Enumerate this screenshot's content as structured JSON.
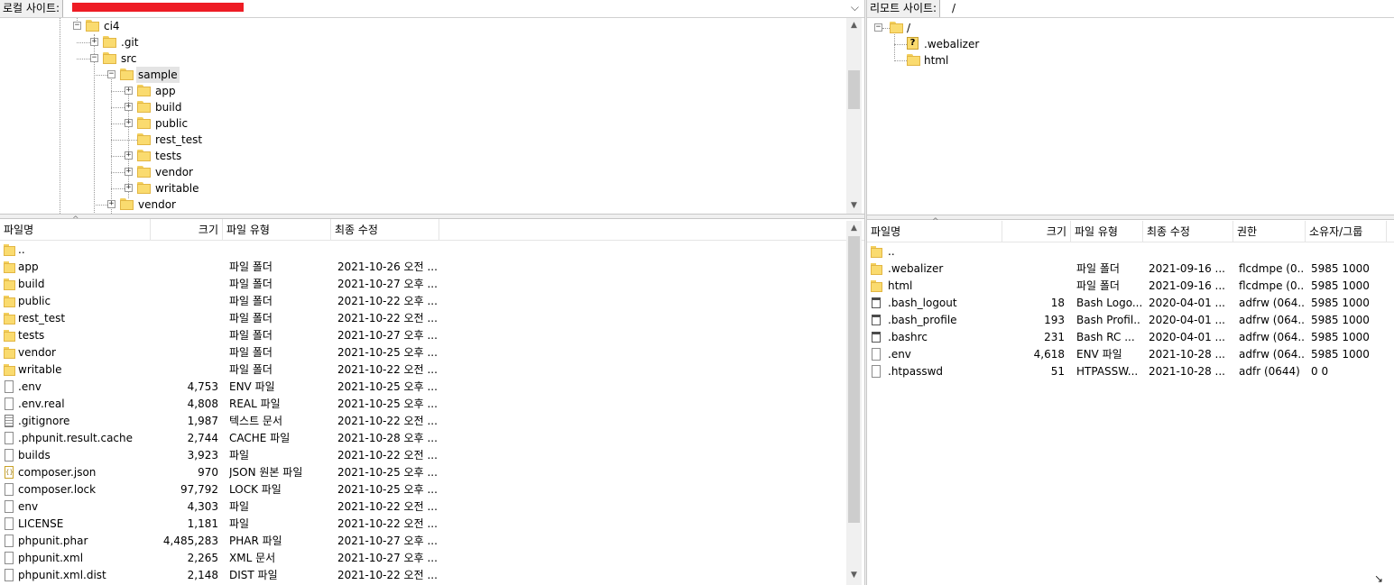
{
  "local": {
    "label": "로컬 사이트:",
    "tree": [
      {
        "label": "ci4",
        "level": 0,
        "expander": "-",
        "selected": false
      },
      {
        "label": ".git",
        "level": 1,
        "expander": "+",
        "selected": false
      },
      {
        "label": "src",
        "level": 1,
        "expander": "-",
        "selected": false
      },
      {
        "label": "sample",
        "level": 2,
        "expander": "-",
        "selected": true
      },
      {
        "label": "app",
        "level": 3,
        "expander": "+",
        "selected": false
      },
      {
        "label": "build",
        "level": 3,
        "expander": "+",
        "selected": false
      },
      {
        "label": "public",
        "level": 3,
        "expander": "+",
        "selected": false
      },
      {
        "label": "rest_test",
        "level": 3,
        "expander": "",
        "selected": false
      },
      {
        "label": "tests",
        "level": 3,
        "expander": "+",
        "selected": false
      },
      {
        "label": "vendor",
        "level": 3,
        "expander": "+",
        "selected": false
      },
      {
        "label": "writable",
        "level": 3,
        "expander": "+",
        "selected": false
      },
      {
        "label": "vendor",
        "level": 2,
        "expander": "+",
        "selected": false
      }
    ],
    "columns": {
      "name": "파일명",
      "size": "크기",
      "type": "파일 유형",
      "modified": "최종 수정"
    },
    "files": [
      {
        "name": "..",
        "size": "",
        "type": "",
        "modified": "",
        "icon": "folder"
      },
      {
        "name": "app",
        "size": "",
        "type": "파일 폴더",
        "modified": "2021-10-26 오전 ...",
        "icon": "folder"
      },
      {
        "name": "build",
        "size": "",
        "type": "파일 폴더",
        "modified": "2021-10-27 오후 ...",
        "icon": "folder"
      },
      {
        "name": "public",
        "size": "",
        "type": "파일 폴더",
        "modified": "2021-10-22 오후 ...",
        "icon": "folder"
      },
      {
        "name": "rest_test",
        "size": "",
        "type": "파일 폴더",
        "modified": "2021-10-22 오전 ...",
        "icon": "folder"
      },
      {
        "name": "tests",
        "size": "",
        "type": "파일 폴더",
        "modified": "2021-10-27 오후 ...",
        "icon": "folder"
      },
      {
        "name": "vendor",
        "size": "",
        "type": "파일 폴더",
        "modified": "2021-10-25 오후 ...",
        "icon": "folder"
      },
      {
        "name": "writable",
        "size": "",
        "type": "파일 폴더",
        "modified": "2021-10-22 오전 ...",
        "icon": "folder"
      },
      {
        "name": ".env",
        "size": "4,753",
        "type": "ENV 파일",
        "modified": "2021-10-25 오후 ...",
        "icon": "file"
      },
      {
        "name": ".env.real",
        "size": "4,808",
        "type": "REAL 파일",
        "modified": "2021-10-25 오후 ...",
        "icon": "file"
      },
      {
        "name": ".gitignore",
        "size": "1,987",
        "type": "텍스트 문서",
        "modified": "2021-10-22 오전 ...",
        "icon": "text"
      },
      {
        "name": ".phpunit.result.cache",
        "size": "2,744",
        "type": "CACHE 파일",
        "modified": "2021-10-28 오후 ...",
        "icon": "file"
      },
      {
        "name": "builds",
        "size": "3,923",
        "type": "파일",
        "modified": "2021-10-22 오전 ...",
        "icon": "file"
      },
      {
        "name": "composer.json",
        "size": "970",
        "type": "JSON 원본 파일",
        "modified": "2021-10-25 오후 ...",
        "icon": "json"
      },
      {
        "name": "composer.lock",
        "size": "97,792",
        "type": "LOCK 파일",
        "modified": "2021-10-25 오후 ...",
        "icon": "file"
      },
      {
        "name": "env",
        "size": "4,303",
        "type": "파일",
        "modified": "2021-10-22 오전 ...",
        "icon": "file"
      },
      {
        "name": "LICENSE",
        "size": "1,181",
        "type": "파일",
        "modified": "2021-10-22 오전 ...",
        "icon": "file"
      },
      {
        "name": "phpunit.phar",
        "size": "4,485,283",
        "type": "PHAR 파일",
        "modified": "2021-10-27 오후 ...",
        "icon": "file"
      },
      {
        "name": "phpunit.xml",
        "size": "2,265",
        "type": "XML 문서",
        "modified": "2021-10-27 오후 ...",
        "icon": "file"
      },
      {
        "name": "phpunit.xml.dist",
        "size": "2,148",
        "type": "DIST 파일",
        "modified": "2021-10-22 오전 ...",
        "icon": "file"
      }
    ]
  },
  "remote": {
    "label": "리모트 사이트:",
    "path": "/",
    "tree": [
      {
        "label": "/",
        "level": 0,
        "expander": "-",
        "icon": "folder"
      },
      {
        "label": ".webalizer",
        "level": 1,
        "expander": "",
        "icon": "unknown"
      },
      {
        "label": "html",
        "level": 1,
        "expander": "",
        "icon": "folder"
      }
    ],
    "unknown_glyph": "?",
    "columns": {
      "name": "파일명",
      "size": "크기",
      "type": "파일 유형",
      "modified": "최종 수정",
      "perms": "권한",
      "owner": "소유자/그룹"
    },
    "files": [
      {
        "name": "..",
        "size": "",
        "type": "",
        "modified": "",
        "perms": "",
        "owner": "",
        "icon": "folder"
      },
      {
        "name": ".webalizer",
        "size": "",
        "type": "파일 폴더",
        "modified": "2021-09-16 ...",
        "perms": "flcdmpe (0...",
        "owner": "5985 1000",
        "icon": "folder"
      },
      {
        "name": "html",
        "size": "",
        "type": "파일 폴더",
        "modified": "2021-09-16 ...",
        "perms": "flcdmpe (0...",
        "owner": "5985 1000",
        "icon": "folder"
      },
      {
        "name": ".bash_logout",
        "size": "18",
        "type": "Bash Logo...",
        "modified": "2020-04-01 ...",
        "perms": "adfrw (064...",
        "owner": "5985 1000",
        "icon": "shell"
      },
      {
        "name": ".bash_profile",
        "size": "193",
        "type": "Bash Profil...",
        "modified": "2020-04-01 ...",
        "perms": "adfrw (064...",
        "owner": "5985 1000",
        "icon": "shell"
      },
      {
        "name": ".bashrc",
        "size": "231",
        "type": "Bash RC ...",
        "modified": "2020-04-01 ...",
        "perms": "adfrw (064...",
        "owner": "5985 1000",
        "icon": "shell"
      },
      {
        "name": ".env",
        "size": "4,618",
        "type": "ENV 파일",
        "modified": "2021-10-28 ...",
        "perms": "adfrw (064...",
        "owner": "5985 1000",
        "icon": "file"
      },
      {
        "name": ".htpasswd",
        "size": "51",
        "type": "HTPASSW...",
        "modified": "2021-10-28 ...",
        "perms": "adfr (0644)",
        "owner": "0 0",
        "icon": "file"
      }
    ]
  },
  "icons": {
    "scroll_up": "▲",
    "scroll_down": "▼",
    "dropdown": "⌵",
    "sort": "^",
    "cursor": "↘"
  },
  "colors": {
    "folder": "#fadb6f",
    "redaction": "#ee1c24",
    "selection": "#e4e4e4"
  }
}
